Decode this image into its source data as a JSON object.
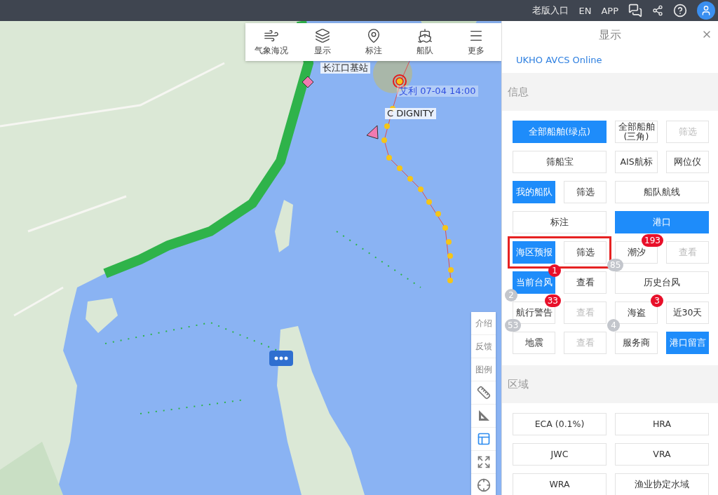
{
  "top_bar": {
    "links": [
      "老版入口",
      "EN",
      "APP"
    ]
  },
  "map_toolbar": [
    {
      "kind": "wind",
      "label": "气象海况"
    },
    {
      "kind": "layers",
      "label": "显示"
    },
    {
      "kind": "pin",
      "label": "标注"
    },
    {
      "kind": "ship",
      "label": "船队"
    },
    {
      "kind": "menu",
      "label": "更多"
    }
  ],
  "map_labels": [
    {
      "kind": "station",
      "text": "长江口基站"
    },
    {
      "kind": "typhoon",
      "text": "艾利 07-04 14:00"
    },
    {
      "kind": "ship",
      "text": "C DIGNITY"
    }
  ],
  "side_tools": [
    {
      "kind": "text",
      "label": "介绍",
      "active": false
    },
    {
      "kind": "text",
      "label": "反馈",
      "active": false
    },
    {
      "kind": "text",
      "label": "图例",
      "active": false
    },
    {
      "kind": "ruler",
      "active": false
    },
    {
      "kind": "set-square",
      "active": false
    },
    {
      "kind": "layout",
      "active": true
    },
    {
      "kind": "expand",
      "active": false
    },
    {
      "kind": "locate",
      "active": false
    }
  ],
  "panel": {
    "title": "显示",
    "link": "UKHO AVCS Online",
    "sections": [
      {
        "title": "信息",
        "rows": [
          [
            {
              "label": "全部船舶(绿点)",
              "selected": true,
              "disabled": false,
              "wide": true
            },
            {
              "label": "全部船舶(三角)",
              "selected": false,
              "disabled": false,
              "wide": false
            },
            {
              "label": "筛选",
              "selected": false,
              "disabled": true,
              "wide": false
            }
          ],
          [
            {
              "label": "筛船宝",
              "selected": false,
              "disabled": false,
              "wide": true
            },
            {
              "label": "AIS航标",
              "selected": false,
              "disabled": false,
              "wide": false
            },
            {
              "label": "网位仪",
              "selected": false,
              "disabled": false,
              "wide": false
            }
          ],
          [
            {
              "label": "我的船队",
              "selected": true,
              "disabled": false,
              "wide": false
            },
            {
              "label": "筛选",
              "selected": false,
              "disabled": false,
              "wide": false
            },
            {
              "label": "船队航线",
              "selected": false,
              "disabled": false,
              "wide": true
            }
          ],
          [
            {
              "label": "标注",
              "selected": false,
              "disabled": false,
              "wide": true
            },
            {
              "label": "港口",
              "selected": true,
              "disabled": false,
              "wide": true
            }
          ],
          [
            {
              "label": "海区预报",
              "selected": true,
              "disabled": false,
              "wide": false,
              "boxed": true
            },
            {
              "label": "筛选",
              "selected": false,
              "disabled": false,
              "wide": false,
              "boxed": true
            },
            {
              "label": "潮汐",
              "selected": false,
              "disabled": false,
              "wide": false,
              "badges": [
                {
                  "color": "#e8102a",
                  "text": "193"
                },
                {
                  "color": "#c3c6cc",
                  "text": "85"
                }
              ]
            },
            {
              "label": "查看",
              "selected": false,
              "disabled": true,
              "wide": false
            }
          ],
          [
            {
              "label": "当前台风",
              "selected": true,
              "disabled": false,
              "wide": false,
              "badges": [
                {
                  "color": "#e8102a",
                  "text": "1"
                },
                {
                  "color": "#c3c6cc",
                  "text": "2"
                }
              ]
            },
            {
              "label": "查看",
              "selected": false,
              "disabled": false,
              "wide": false
            },
            {
              "label": "历史台风",
              "selected": false,
              "disabled": false,
              "wide": true
            }
          ],
          [
            {
              "label": "航行警告",
              "selected": false,
              "disabled": false,
              "wide": false,
              "badges": [
                {
                  "color": "#e8102a",
                  "text": "33"
                },
                {
                  "color": "#c3c6cc",
                  "text": "53"
                }
              ]
            },
            {
              "label": "查看",
              "selected": false,
              "disabled": true,
              "wide": false
            },
            {
              "label": "海盗",
              "selected": false,
              "disabled": false,
              "wide": false,
              "badges": [
                {
                  "color": "#e8102a",
                  "text": "3"
                },
                {
                  "color": "#c3c6cc",
                  "text": "4"
                }
              ]
            },
            {
              "label": "近30天",
              "selected": false,
              "disabled": false,
              "wide": false
            }
          ],
          [
            {
              "label": "地震",
              "selected": false,
              "disabled": false,
              "wide": false
            },
            {
              "label": "查看",
              "selected": false,
              "disabled": true,
              "wide": false
            },
            {
              "label": "服务商",
              "selected": false,
              "disabled": false,
              "wide": false
            },
            {
              "label": "港口留言",
              "selected": true,
              "disabled": false,
              "wide": false
            }
          ]
        ]
      },
      {
        "title": "区域",
        "rows": [
          [
            {
              "label": "ECA (0.1%)",
              "selected": false,
              "disabled": false,
              "wide": true
            },
            {
              "label": "HRA",
              "selected": false,
              "disabled": false,
              "wide": true
            }
          ],
          [
            {
              "label": "JWC",
              "selected": false,
              "disabled": false,
              "wide": true
            },
            {
              "label": "VRA",
              "selected": false,
              "disabled": false,
              "wide": true
            }
          ],
          [
            {
              "label": "WRA",
              "selected": false,
              "disabled": false,
              "wide": true
            },
            {
              "label": "渔业协定水域",
              "selected": false,
              "disabled": false,
              "wide": true
            }
          ]
        ]
      }
    ]
  }
}
